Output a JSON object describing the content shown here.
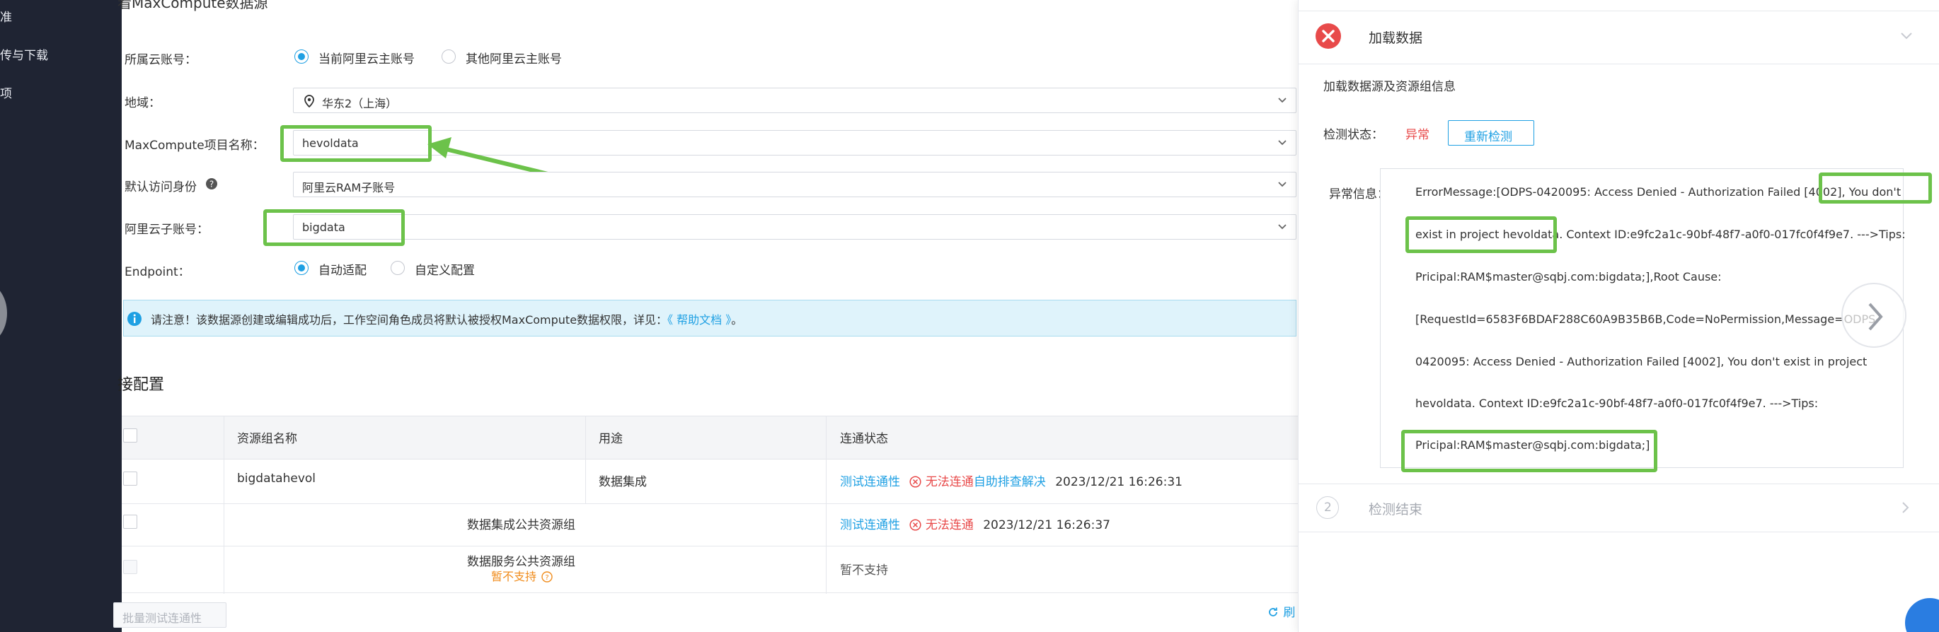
{
  "sidebar": {
    "items": [
      {
        "label": "准"
      },
      {
        "label": "传与下载"
      },
      {
        "label": "项"
      }
    ]
  },
  "form": {
    "title": "看MaxCompute数据源",
    "account_label": "所属云账号：",
    "account_options": [
      "当前阿里云主账号",
      "其他阿里云主账号"
    ],
    "region_label": "地域：",
    "region_value": "华东2（上海）",
    "project_label": "MaxCompute项目名称：",
    "project_value": "hevoldata",
    "identity_label": "默认访问身份",
    "identity_value": "阿里云RAM子账号",
    "subaccount_label": "阿里云子账号：",
    "subaccount_value": "bigdata",
    "endpoint_label": "Endpoint：",
    "endpoint_options": [
      "自动适配",
      "自定义配置"
    ]
  },
  "notice": {
    "text": "请注意！该数据源创建或编辑成功后，工作空间角色成员将默认被授权MaxCompute数据权限，详见：",
    "link": "《 帮助文档 》",
    "suffix": "。"
  },
  "connection": {
    "title": "接配置",
    "columns": [
      "资源组名称",
      "用途",
      "连通状态"
    ],
    "rows": [
      {
        "name": "bigdatahevol",
        "usage": "数据集成",
        "test_link": "测试连通性",
        "status": "无法连通",
        "fix_link": "自助排查解决",
        "time": "2023/12/21 16:26:31"
      },
      {
        "name": "数据集成公共资源组",
        "usage": "",
        "test_link": "测试连通性",
        "status": "无法连通",
        "fix_link": "",
        "time": "2023/12/21 16:26:37"
      },
      {
        "name": "数据服务公共资源组",
        "sub": "暂不支持",
        "usage": "",
        "status_text": "暂不支持"
      }
    ],
    "batch_button": "批量测试连通性",
    "refresh_label": "刷"
  },
  "panel": {
    "step1_title": "加载数据",
    "section_title": "加载数据源及资源组信息",
    "check_label": "检测状态：",
    "check_value": "异常",
    "recheck_button": "重新检测",
    "error_label": "异常信息：",
    "error_lines": [
      "ErrorMessage:[ODPS-0420095: Access Denied - Authorization Failed [4002], You don't",
      "exist in project hevoldata. Context ID:e9fc2a1c-90bf-48f7-a0f0-017fc0f4f9e7. --->Tips:",
      "Pricipal:RAM$master@sqbj.com:bigdata;],Root Cause:",
      "[RequestId=6583F6BDAF288C60A9B35B6B,Code=NoPermission,Message=ODPS-",
      "0420095: Access Denied - Authorization Failed [4002], You don't exist in project",
      "hevoldata. Context ID:e9fc2a1c-90bf-48f7-a0f0-017fc0f4f9e7. --->Tips:",
      "Pricipal:RAM$master@sqbj.com:bigdata;]"
    ],
    "step2_number": "2",
    "step2_title": "检测结束"
  },
  "colors": {
    "accent": "#1fa0e3",
    "error": "#e84a4a",
    "highlight": "#6cc24a",
    "warning": "#f08c1c"
  }
}
